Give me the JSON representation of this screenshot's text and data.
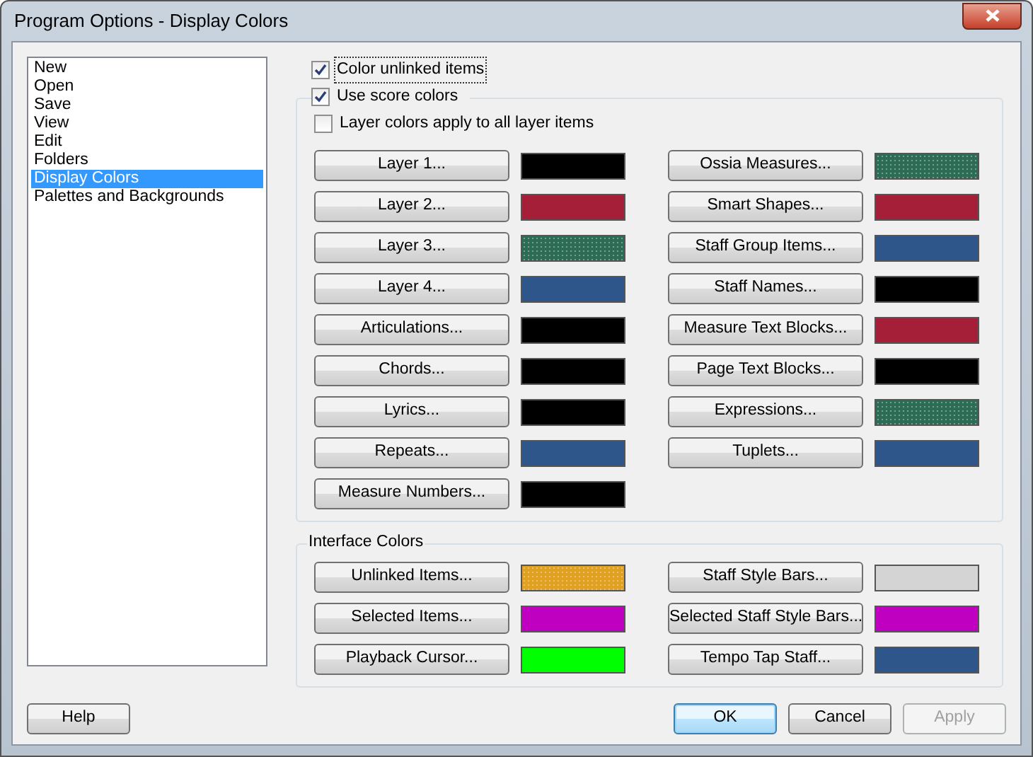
{
  "window": {
    "title": "Program Options - Display Colors"
  },
  "sidebar": {
    "items": [
      {
        "label": "New",
        "selected": false
      },
      {
        "label": "Open",
        "selected": false
      },
      {
        "label": "Save",
        "selected": false
      },
      {
        "label": "View",
        "selected": false
      },
      {
        "label": "Edit",
        "selected": false
      },
      {
        "label": "Folders",
        "selected": false
      },
      {
        "label": "Display Colors",
        "selected": true
      },
      {
        "label": "Palettes and Backgrounds",
        "selected": false
      }
    ]
  },
  "options": [
    {
      "label": "Color unlinked items",
      "checked": true,
      "focused": true
    }
  ],
  "score_colors": {
    "label": "Use score colors",
    "checked": true,
    "options": [
      {
        "label": "Layer colors apply to all layer items",
        "checked": false
      }
    ],
    "columns": [
      [
        {
          "label": "Layer 1...",
          "color": "#000000",
          "dotted": false
        },
        {
          "label": "Layer 2...",
          "color": "#a51f38",
          "dotted": false
        },
        {
          "label": "Layer 3...",
          "color": "#2c6b54",
          "dotted": true
        },
        {
          "label": "Layer 4...",
          "color": "#2f568b",
          "dotted": false
        },
        {
          "label": "Articulations...",
          "color": "#000000",
          "dotted": false
        },
        {
          "label": "Chords...",
          "color": "#000000",
          "dotted": false
        },
        {
          "label": "Lyrics...",
          "color": "#000000",
          "dotted": false
        },
        {
          "label": "Repeats...",
          "color": "#2f568b",
          "dotted": false
        },
        {
          "label": "Measure Numbers...",
          "color": "#000000",
          "dotted": false
        }
      ],
      [
        {
          "label": "Ossia Measures...",
          "color": "#2c6b54",
          "dotted": true
        },
        {
          "label": "Smart Shapes...",
          "color": "#a51f38",
          "dotted": false
        },
        {
          "label": "Staff Group Items...",
          "color": "#2f568b",
          "dotted": false
        },
        {
          "label": "Staff Names...",
          "color": "#000000",
          "dotted": false
        },
        {
          "label": "Measure Text Blocks...",
          "color": "#a51f38",
          "dotted": false
        },
        {
          "label": "Page Text Blocks...",
          "color": "#000000",
          "dotted": false
        },
        {
          "label": "Expressions...",
          "color": "#2c6b54",
          "dotted": true
        },
        {
          "label": "Tuplets...",
          "color": "#2f568b",
          "dotted": false
        }
      ]
    ]
  },
  "interface_colors": {
    "title": "Interface Colors",
    "columns": [
      [
        {
          "label": "Unlinked Items...",
          "color": "#e0a020",
          "dotted": true
        },
        {
          "label": "Selected Items...",
          "color": "#c000c0",
          "dotted": false
        },
        {
          "label": "Playback Cursor...",
          "color": "#00ff00",
          "dotted": false
        }
      ],
      [
        {
          "label": "Staff Style Bars...",
          "color": "#d4d4d4",
          "dotted": false
        },
        {
          "label": "Selected Staff Style Bars...",
          "color": "#c000c0",
          "dotted": false
        },
        {
          "label": "Tempo Tap Staff...",
          "color": "#2f568b",
          "dotted": false
        }
      ]
    ]
  },
  "footer": {
    "left": [
      {
        "label": "Help",
        "default": false,
        "disabled": false
      }
    ],
    "right": [
      {
        "label": "OK",
        "default": true,
        "disabled": false
      },
      {
        "label": "Cancel",
        "default": false,
        "disabled": false
      },
      {
        "label": "Apply",
        "default": false,
        "disabled": true
      }
    ]
  }
}
